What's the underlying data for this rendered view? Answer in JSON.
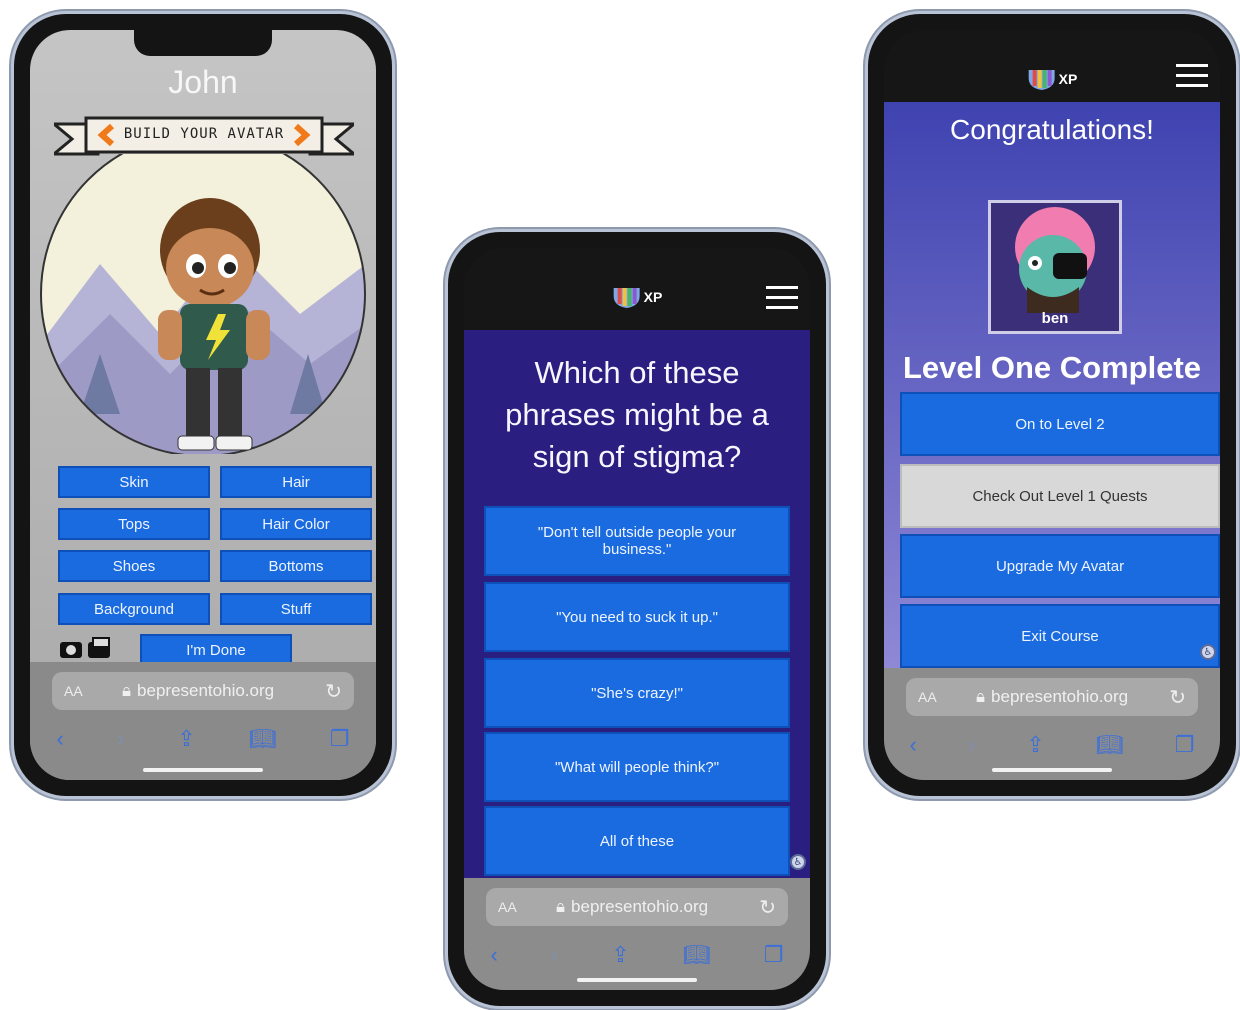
{
  "phone1": {
    "name": "John",
    "banner": "BUILD YOUR AVATAR",
    "buttons": [
      "Skin",
      "Hair",
      "Tops",
      "Hair Color",
      "Shoes",
      "Bottoms",
      "Background",
      "Stuff"
    ],
    "done": "I'm Done",
    "browser": {
      "aa": "AA",
      "url": "bepresentohio.org"
    }
  },
  "phone2": {
    "logo_text": "XP",
    "question": "Which of these phrases might be a sign of stigma?",
    "answers": [
      "\"Don't tell outside people your business.\"",
      "\"You need to suck it up.\"",
      "\"She's crazy!\"",
      "\"What will people think?\"",
      "All of these"
    ],
    "browser": {
      "aa": "AA",
      "url": "bepresentohio.org"
    }
  },
  "phone3": {
    "logo_text": "XP",
    "congrats": "Congratulations!",
    "avatar_name": "ben",
    "level_complete": "Level One Complete",
    "buttons": [
      "On to Level 2",
      "Check Out Level 1 Quests",
      "Upgrade My Avatar",
      "Exit Course"
    ],
    "browser": {
      "aa": "AA",
      "url": "bepresentohio.org"
    }
  },
  "colors": {
    "button_blue": "#1a6be0",
    "quiz_purple": "#2a1f80",
    "gradient_top": "#3f43b0",
    "gradient_bottom": "#8f88d6"
  }
}
